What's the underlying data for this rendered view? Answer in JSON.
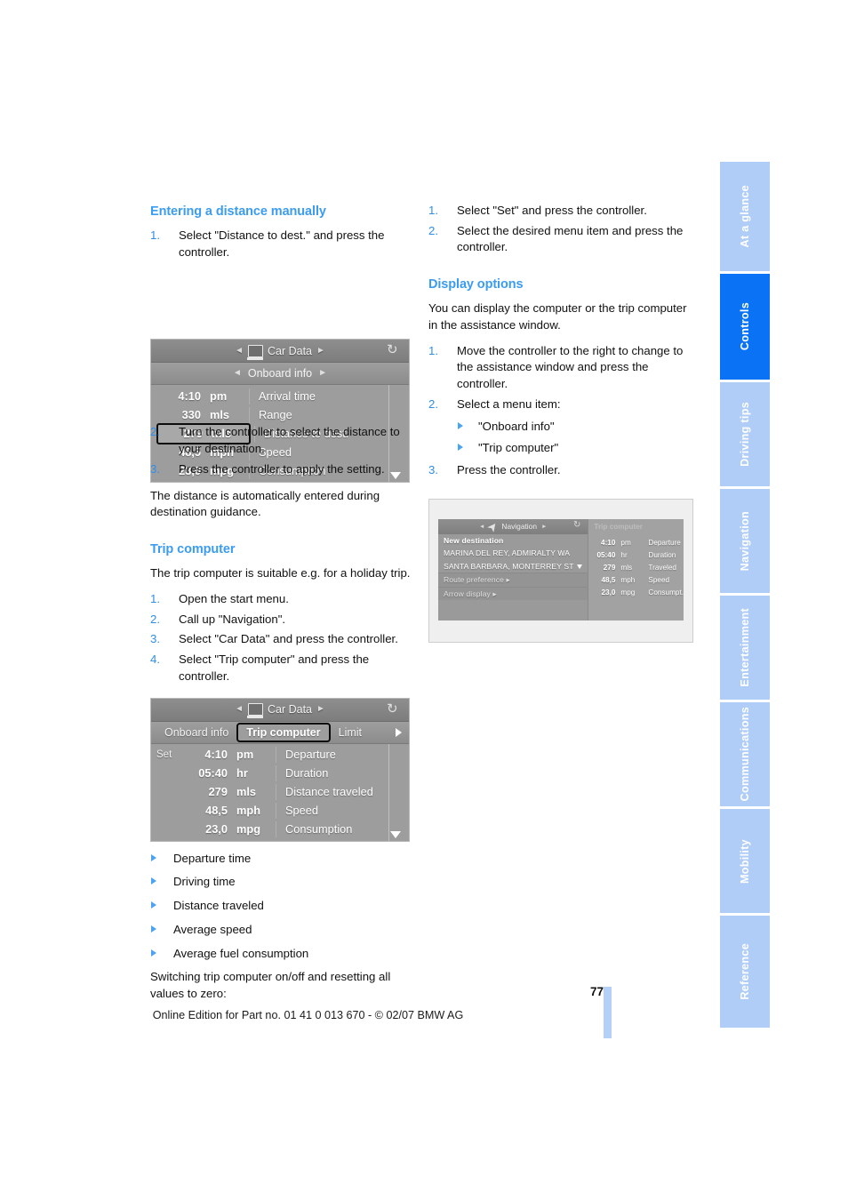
{
  "page": {
    "number": "77",
    "footer_note": "Online Edition for Part no. 01 41 0 013 670 - © 02/07 BMW AG",
    "accent_blue": "#3b9cf0",
    "active_tab_blue": "#0a72f5",
    "inactive_tab_blue": "#b0cdf7"
  },
  "left_column": {
    "heading_1": "Entering a distance manually",
    "steps_1": [
      {
        "num": "1.",
        "text": "Select \"Distance to dest.\" and press the controller."
      }
    ],
    "steps_2": [
      {
        "num": "2.",
        "text": "Turn the controller to select the distance to your destination."
      },
      {
        "num": "3.",
        "text": "Press the controller to apply the setting."
      }
    ],
    "paragraph_1": "The distance is automatically entered during destination guidance.",
    "heading_2": "Trip computer",
    "paragraph_2": "The trip computer is suitable e.g. for a holiday trip.",
    "steps_3": [
      {
        "num": "1.",
        "text": "Open the start menu."
      },
      {
        "num": "2.",
        "text": "Call up \"Navigation\"."
      },
      {
        "num": "3.",
        "text": "Select \"Car Data\" and press the controller."
      },
      {
        "num": "4.",
        "text": "Select \"Trip computer\" and press the controller."
      }
    ],
    "bullets": [
      "Departure time",
      "Driving time",
      "Distance traveled",
      "Average speed",
      "Average fuel consumption"
    ],
    "paragraph_3": "Switching trip computer on/off and resetting all values to zero:"
  },
  "right_column": {
    "steps_1": [
      {
        "num": "1.",
        "text": "Select \"Set\" and press the controller."
      },
      {
        "num": "2.",
        "text": "Select the desired menu item and press the controller."
      }
    ],
    "heading_1": "Display options",
    "paragraph_1": "You can display the computer or the trip computer in the assistance window.",
    "steps_2": [
      {
        "num": "1.",
        "text": "Move the controller to the right to change to the assistance window and press the controller."
      },
      {
        "num": "2.",
        "text": "Select a menu item:"
      }
    ],
    "sub_bullets": [
      "\"Onboard info\"",
      "\"Trip computer\""
    ],
    "steps_3": [
      {
        "num": "3.",
        "text": "Press the controller."
      }
    ]
  },
  "figure_onboard_info": {
    "title": "Car Data",
    "title_prev_arrow": "◄",
    "title_next_arrow": "►",
    "tab": "Onboard info",
    "tab_prev_arrow": "◄",
    "tab_next_arrow": "►",
    "rows": [
      {
        "value": "4:10",
        "unit": "pm",
        "label": "Arrival time",
        "highlight": false
      },
      {
        "value": "330",
        "unit": "mls",
        "label": "Range",
        "highlight": false
      },
      {
        "value": "279",
        "unit": "mls",
        "label": "Distance to dest.",
        "highlight": true
      },
      {
        "value": "48,5",
        "unit": "mph",
        "label": "Speed",
        "highlight": false
      },
      {
        "value": "23,0",
        "unit": "mpg",
        "label": "Consumption",
        "highlight": false
      }
    ]
  },
  "figure_trip_computer": {
    "title": "Car Data",
    "title_prev_arrow": "◄",
    "title_next_arrow": "►",
    "tabs": [
      {
        "label": "Onboard info",
        "active": false
      },
      {
        "label": "Trip computer",
        "active": true
      },
      {
        "label": "Limit",
        "active": false
      }
    ],
    "set_label": "Set",
    "rows": [
      {
        "value": "4:10",
        "unit": "pm",
        "label": "Departure"
      },
      {
        "value": "05:40",
        "unit": "hr",
        "label": "Duration"
      },
      {
        "value": "279",
        "unit": "mls",
        "label": "Distance traveled"
      },
      {
        "value": "48,5",
        "unit": "mph",
        "label": "Speed"
      },
      {
        "value": "23,0",
        "unit": "mpg",
        "label": "Consumption"
      }
    ]
  },
  "figure_navigation_split": {
    "left_panel": {
      "title": "Navigation",
      "title_prev_arrow": "◄",
      "title_next_arrow": "►",
      "rows": [
        {
          "text": "New destination",
          "style": "bold"
        },
        {
          "text": "MARINA DEL REY, ADMIRALTY WA",
          "style": "normal"
        },
        {
          "text": "SANTA BARBARA, MONTERREY ST",
          "style": "normal"
        },
        {
          "text": "Route preference ▸",
          "style": "dim"
        },
        {
          "text": "Arrow display ▸",
          "style": "dim"
        }
      ]
    },
    "right_panel": {
      "title": "Trip computer",
      "rows": [
        {
          "value": "4:10",
          "unit": "pm",
          "label": "Departure"
        },
        {
          "value": "05:40",
          "unit": "hr",
          "label": "Duration"
        },
        {
          "value": "279",
          "unit": "mls",
          "label": "Traveled"
        },
        {
          "value": "48,5",
          "unit": "mph",
          "label": "Speed"
        },
        {
          "value": "23,0",
          "unit": "mpg",
          "label": "Consumpt."
        }
      ]
    }
  },
  "side_tabs": [
    {
      "label": "At a glance",
      "active": false
    },
    {
      "label": "Controls",
      "active": true
    },
    {
      "label": "Driving tips",
      "active": false
    },
    {
      "label": "Navigation",
      "active": false
    },
    {
      "label": "Entertainment",
      "active": false
    },
    {
      "label": "Communications",
      "active": false
    },
    {
      "label": "Mobility",
      "active": false
    },
    {
      "label": "Reference",
      "active": false
    }
  ]
}
